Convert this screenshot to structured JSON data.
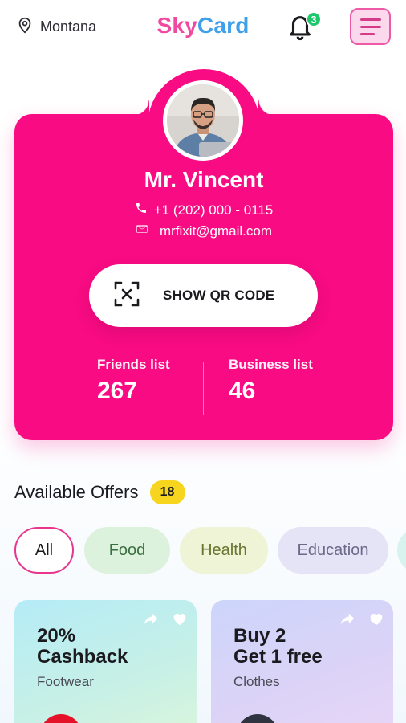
{
  "header": {
    "location": "Montana",
    "brand_part1": "Sky",
    "brand_part2": "Card",
    "notifications_count": "3"
  },
  "profile": {
    "name": "Mr. Vincent",
    "phone": "+1 (202) 000 - 0115",
    "email": "mrfixit@gmail.com",
    "qr_button_label": "SHOW  QR CODE",
    "stats": {
      "friends_label": "Friends list",
      "friends_value": "267",
      "business_label": "Business list",
      "business_value": "46"
    }
  },
  "offers": {
    "title": "Available Offers",
    "count": "18",
    "chips": [
      "All",
      "Food",
      "Health",
      "Education"
    ],
    "selected_chip": "All",
    "cards": [
      {
        "title_line1": "20%",
        "title_line2": "Cashback",
        "category": "Footwear"
      },
      {
        "title_line1": "Buy 2",
        "title_line2": "Get 1 free",
        "category": "Clothes"
      }
    ]
  },
  "colors": {
    "card": "#f80b83",
    "brand_pink": "#ef4aa0",
    "brand_blue": "#3fa0ea",
    "badge_green": "#1ec76c",
    "count_yellow": "#f7d51f"
  }
}
